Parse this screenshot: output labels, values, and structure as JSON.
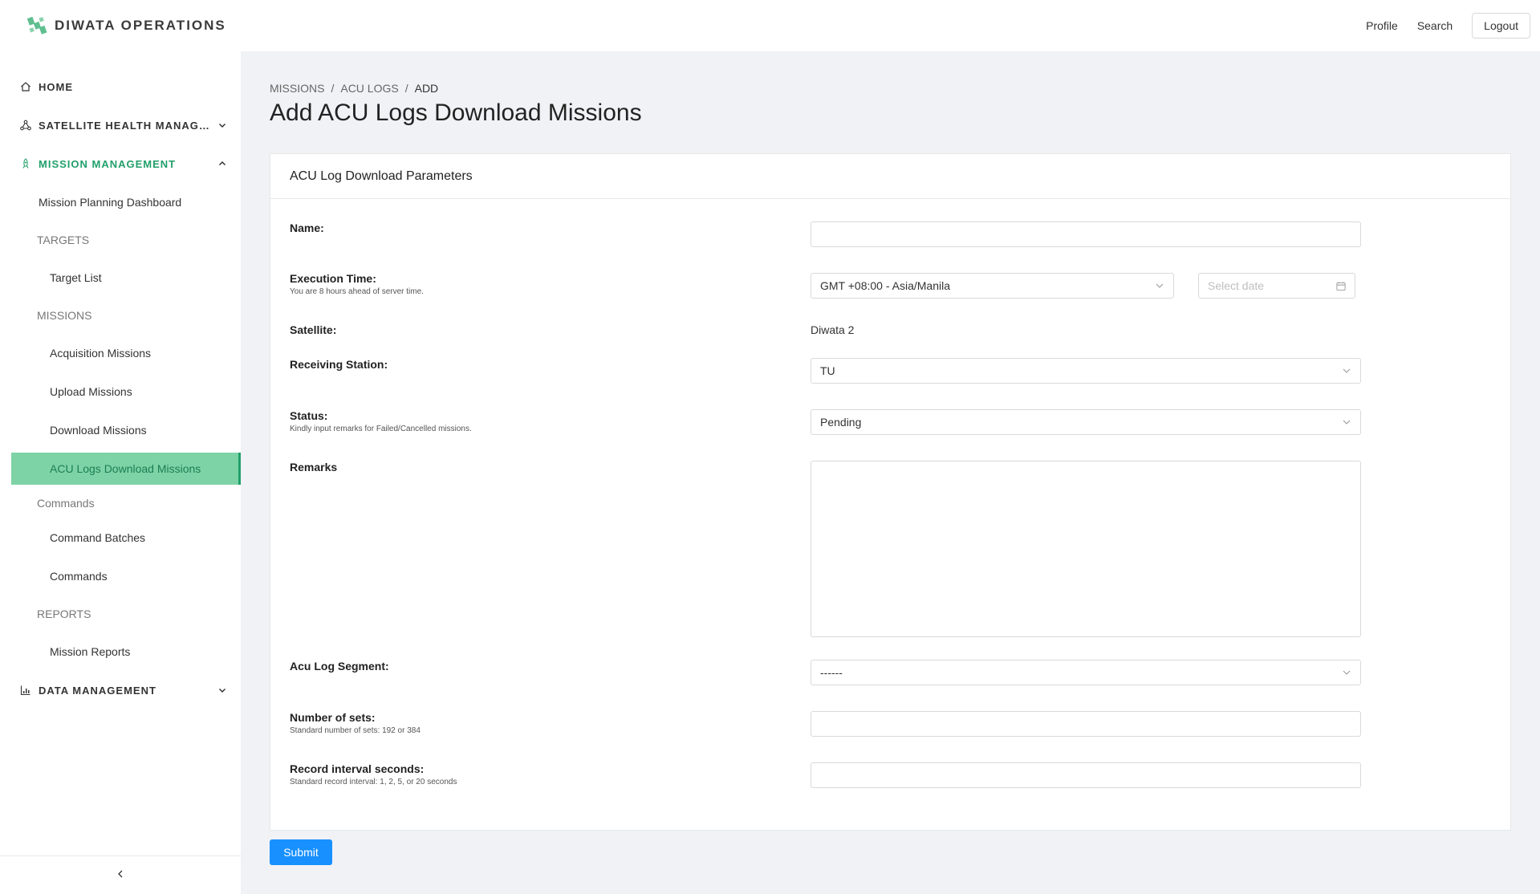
{
  "header": {
    "brand": "DIWATA OPERATIONS",
    "links": {
      "profile": "Profile",
      "search": "Search",
      "logout": "Logout"
    }
  },
  "sidebar": {
    "home": "HOME",
    "satellite_health": "SATELLITE HEALTH MANAGE...",
    "mission_management": "MISSION MANAGEMENT",
    "mission_planning_dashboard": "Mission Planning Dashboard",
    "targets_group": "TARGETS",
    "target_list": "Target List",
    "missions_group": "MISSIONS",
    "acquisition_missions": "Acquisition Missions",
    "upload_missions": "Upload Missions",
    "download_missions": "Download Missions",
    "acu_logs_download_missions": "ACU Logs Download Missions",
    "commands_group": "Commands",
    "command_batches": "Command Batches",
    "commands": "Commands",
    "reports_group": "REPORTS",
    "mission_reports": "Mission Reports",
    "data_management": "DATA MANAGEMENT"
  },
  "breadcrumb": {
    "missions": "MISSIONS",
    "acu_logs": "ACU LOGS",
    "add": "ADD",
    "sep": "/"
  },
  "page": {
    "title": "Add ACU Logs Download Missions"
  },
  "form": {
    "card_title": "ACU Log Download Parameters",
    "name_label": "Name:",
    "name_value": "",
    "execution_time_label": "Execution Time:",
    "execution_time_hint": "You are 8 hours ahead of server time.",
    "timezone_value": "GMT +08:00 - Asia/Manila",
    "date_placeholder": "Select date",
    "satellite_label": "Satellite:",
    "satellite_value": "Diwata 2",
    "receiving_station_label": "Receiving Station:",
    "receiving_station_value": "TU",
    "status_label": "Status:",
    "status_hint": "Kindly input remarks for Failed/Cancelled missions.",
    "status_value": "Pending",
    "remarks_label": "Remarks",
    "remarks_value": "",
    "acu_log_segment_label": "Acu Log Segment:",
    "acu_log_segment_value": "------",
    "number_of_sets_label": "Number of sets:",
    "number_of_sets_hint": "Standard number of sets: 192 or 384",
    "number_of_sets_value": "",
    "record_interval_label": "Record interval seconds:",
    "record_interval_hint": "Standard record interval: 1, 2, 5, or 20 seconds",
    "record_interval_value": "",
    "submit": "Submit"
  },
  "colors": {
    "accent_green": "#22a06b",
    "selected_bg": "#7ed3a6",
    "primary_blue": "#1890ff"
  }
}
